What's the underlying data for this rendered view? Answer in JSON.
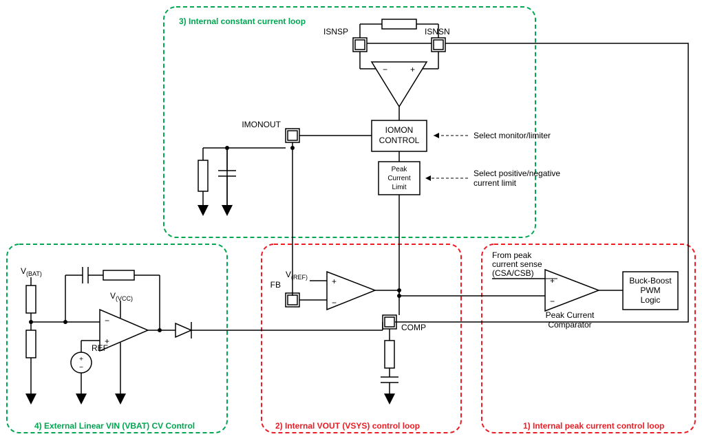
{
  "boxes": {
    "box3_title": "3) Internal constant current loop",
    "box4_title": "4) External Linear  VIN (VBAT) CV Control",
    "box2_title": "2) Internal VOUT (VSYS) control loop",
    "box1_title": "1) Internal peak current control loop"
  },
  "pins": {
    "isnsp": "ISNSP",
    "isnsn": "ISNSN",
    "imonout": "IMONOUT",
    "fb": "FB",
    "comp": "COMP"
  },
  "blocks": {
    "iomon_l1": "IOMON",
    "iomon_l2": "CONTROL",
    "peak_limit_l1": "Peak",
    "peak_limit_l2": "Current",
    "peak_limit_l3": "Limit",
    "pwm_l1": "Buck-Boost",
    "pwm_l2": "PWM",
    "pwm_l3": "Logic"
  },
  "labels": {
    "select_mon": "Select monitor/limiter",
    "select_pos_l1": "Select positive/negative",
    "select_pos_l2": "current limit",
    "from_peak_l1": "From peak",
    "from_peak_l2": "current sense",
    "from_peak_l3": "(CSA/CSB)",
    "peak_comp_l1": "Peak Current",
    "peak_comp_l2": "Comparator",
    "vbat": "V",
    "vbat_sub": "(BAT)",
    "vvcc": "V",
    "vvcc_sub": "(VCC)",
    "vref": "V",
    "vref_sub": "(REF)",
    "ref": "REF"
  }
}
